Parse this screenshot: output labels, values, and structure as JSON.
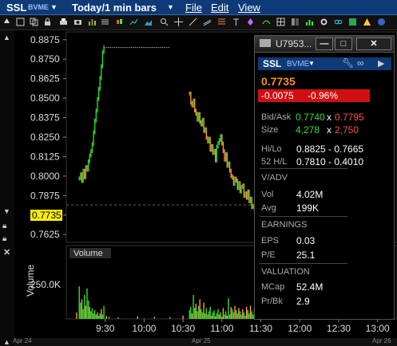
{
  "menubar": {
    "symbol": "SSL",
    "exchange": "BVME",
    "period": "Today/1 min bars",
    "menus": [
      "File",
      "Edit",
      "View"
    ]
  },
  "chart": {
    "price_tag": "0.7735",
    "volume_label": "Volume",
    "volume_axis_title": "Volume",
    "volume_tick": "250.0K",
    "dates": [
      "Apr 24",
      "Apr 25",
      "Apr 26"
    ]
  },
  "chart_data": {
    "type": "bar",
    "title": "",
    "yticks": [
      "0.8875",
      "0.8750",
      "0.8625",
      "0.8500",
      "0.8375",
      "0.8250",
      "0.8125",
      "0.8000",
      "0.7875",
      "0.7750",
      "0.7625"
    ],
    "ylim": [
      0.7575,
      0.8925
    ],
    "xticks": [
      "9:30",
      "10:00",
      "10:30",
      "11:00",
      "11:30",
      "12:00",
      "12:30",
      "13:00"
    ],
    "xlim_minutes": [
      0,
      255
    ],
    "last_price": 0.7735,
    "price_segments": [
      {
        "start": 10,
        "values": [
          0.7985,
          0.8012,
          0.7968,
          0.8035,
          0.7992,
          0.8058,
          0.8041,
          0.8095,
          0.8132,
          0.816,
          0.8205,
          0.8281,
          0.8356,
          0.842,
          0.8495,
          0.856,
          0.863,
          0.8705,
          0.8795,
          0.8825
        ]
      },
      {
        "start": 30,
        "values": [
          0.8825,
          0.8825,
          0.8825,
          0.8825,
          0.8825,
          0.8825,
          0.8825,
          0.8825,
          0.8825,
          0.8825,
          0.8825,
          0.8825,
          0.8825,
          0.8825,
          0.8825,
          0.8825,
          0.8825,
          0.8825,
          0.8825,
          0.8825,
          0.8825,
          0.8825,
          0.8825,
          0.8825,
          0.8825,
          0.8825,
          0.8825,
          0.8825,
          0.8825,
          0.8825,
          0.8825,
          0.8825,
          0.8825,
          0.8825,
          0.8825,
          0.8825,
          0.8825,
          0.8825,
          0.8825,
          0.8825,
          0.8825,
          0.8825,
          0.8825,
          0.8825,
          0.8825,
          0.8825,
          0.8825,
          0.8825,
          0.8825,
          0.8825
        ]
      },
      {
        "start": 95,
        "values": [
          0.853,
          0.847,
          0.8452,
          0.8485,
          0.842,
          0.84,
          0.8361,
          0.8398,
          0.8347,
          0.833,
          0.8362,
          0.8289,
          0.8301,
          0.8246,
          0.8222,
          0.824,
          0.8168,
          0.8194,
          0.8148,
          0.8162,
          0.81,
          0.8189,
          0.8212,
          0.8231,
          0.8257,
          0.8209,
          0.816,
          0.8105,
          0.8141,
          0.8066,
          0.8082,
          0.8035,
          0.8001,
          0.799,
          0.795,
          0.7985,
          0.7971,
          0.7922,
          0.7955,
          0.7901,
          0.793,
          0.794,
          0.7872,
          0.789,
          0.786,
          0.7902,
          0.7838,
          0.7856,
          0.7801,
          0.781,
          0.7792,
          0.773,
          0.7735,
          0.7765,
          0.774,
          0.7735
        ]
      }
    ],
    "volume": {
      "ylim": [
        0,
        330000
      ],
      "tick": "250.0K",
      "bars": [
        {
          "t": 8,
          "v": 30000
        },
        {
          "t": 10,
          "v": 150000
        },
        {
          "t": 11,
          "v": 75000
        },
        {
          "t": 12,
          "v": 90000
        },
        {
          "t": 13,
          "v": 45000
        },
        {
          "t": 14,
          "v": 110000
        },
        {
          "t": 15,
          "v": 60000
        },
        {
          "t": 16,
          "v": 140000
        },
        {
          "t": 17,
          "v": 85000
        },
        {
          "t": 18,
          "v": 55000
        },
        {
          "t": 19,
          "v": 35000
        },
        {
          "t": 20,
          "v": 50000
        },
        {
          "t": 21,
          "v": 25000
        },
        {
          "t": 22,
          "v": 40000
        },
        {
          "t": 23,
          "v": 20000
        },
        {
          "t": 24,
          "v": 30000
        },
        {
          "t": 25,
          "v": 15000
        },
        {
          "t": 26,
          "v": 25000
        },
        {
          "t": 27,
          "v": 45000
        },
        {
          "t": 28,
          "v": 20000
        },
        {
          "t": 29,
          "v": 60000
        },
        {
          "t": 31,
          "v": 15000
        },
        {
          "t": 33,
          "v": 10000
        },
        {
          "t": 40,
          "v": 8000
        },
        {
          "t": 55,
          "v": 12000
        },
        {
          "t": 68,
          "v": 10000
        },
        {
          "t": 80,
          "v": 9000
        },
        {
          "t": 90,
          "v": 15000
        },
        {
          "t": 95,
          "v": 40000
        },
        {
          "t": 96,
          "v": 55000
        },
        {
          "t": 97,
          "v": 25000
        },
        {
          "t": 98,
          "v": 110000
        },
        {
          "t": 99,
          "v": 50000
        },
        {
          "t": 100,
          "v": 70000
        },
        {
          "t": 101,
          "v": 35000
        },
        {
          "t": 102,
          "v": 60000
        },
        {
          "t": 103,
          "v": 90000
        },
        {
          "t": 104,
          "v": 45000
        },
        {
          "t": 105,
          "v": 30000
        },
        {
          "t": 106,
          "v": 75000
        },
        {
          "t": 107,
          "v": 25000
        },
        {
          "t": 108,
          "v": 50000
        },
        {
          "t": 109,
          "v": 20000
        },
        {
          "t": 110,
          "v": 35000
        },
        {
          "t": 111,
          "v": 55000
        },
        {
          "t": 112,
          "v": 15000
        },
        {
          "t": 113,
          "v": 30000
        },
        {
          "t": 114,
          "v": 40000
        },
        {
          "t": 115,
          "v": 12000
        },
        {
          "t": 116,
          "v": 25000
        },
        {
          "t": 117,
          "v": 45000
        },
        {
          "t": 118,
          "v": 20000
        },
        {
          "t": 119,
          "v": 30000
        },
        {
          "t": 120,
          "v": 10000
        },
        {
          "t": 121,
          "v": 50000
        },
        {
          "t": 122,
          "v": 20000
        },
        {
          "t": 123,
          "v": 35000
        },
        {
          "t": 124,
          "v": 15000
        },
        {
          "t": 125,
          "v": 95000
        },
        {
          "t": 126,
          "v": 20000
        },
        {
          "t": 127,
          "v": 55000
        },
        {
          "t": 128,
          "v": 45000
        },
        {
          "t": 129,
          "v": 30000
        },
        {
          "t": 130,
          "v": 60000
        },
        {
          "t": 131,
          "v": 40000
        },
        {
          "t": 132,
          "v": 25000
        },
        {
          "t": 133,
          "v": 50000
        },
        {
          "t": 134,
          "v": 35000
        },
        {
          "t": 135,
          "v": 20000
        },
        {
          "t": 136,
          "v": 45000
        },
        {
          "t": 137,
          "v": 30000
        },
        {
          "t": 138,
          "v": 15000
        },
        {
          "t": 139,
          "v": 55000
        },
        {
          "t": 140,
          "v": 40000
        },
        {
          "t": 141,
          "v": 25000
        },
        {
          "t": 142,
          "v": 60000
        },
        {
          "t": 143,
          "v": 35000
        },
        {
          "t": 144,
          "v": 20000
        },
        {
          "t": 145,
          "v": 45000
        },
        {
          "t": 146,
          "v": 15000
        },
        {
          "t": 147,
          "v": 30000
        },
        {
          "t": 148,
          "v": 25000
        },
        {
          "t": 149,
          "v": 40000
        },
        {
          "t": 150,
          "v": 20000
        }
      ]
    }
  },
  "quote_panel": {
    "window_title": "U7953...",
    "symbol": "SSL",
    "exchange": "BVME",
    "last": "0.7735",
    "change": "-0.0075",
    "change_pct": "-0.96%",
    "bid_ask_label": "Bid/Ask",
    "bid": "0.7740",
    "ask": "0.7795",
    "size_label": "Size",
    "bid_size": "4,278",
    "ask_size": "2,750",
    "x_sep": "x",
    "hilo_label": "Hi/Lo",
    "hilo": "0.8825 - 0.7665",
    "wk52_label": "52 H/L",
    "wk52": "0.7810 - 0.4010",
    "vadv_header": "V/ADV",
    "vol_label": "Vol",
    "vol": "4.02M",
    "avg_label": "Avg",
    "avg": "199K",
    "earnings_header": "EARNINGS",
    "eps_label": "EPS",
    "eps": "0.03",
    "pe_label": "P/E",
    "pe": "25.1",
    "valuation_header": "VALUATION",
    "mcap_label": "MCap",
    "mcap": "52.4M",
    "prbk_label": "Pr/Bk",
    "prbk": "2.9"
  },
  "colors": {
    "up": "#33dd33",
    "down": "#ff9944",
    "price_tag": "#ffee00",
    "change_bg": "#d01010",
    "menubar": "#0e3a78",
    "last_price": "#ff8c1a",
    "bid": "#33dd33",
    "ask": "#ff5533"
  }
}
